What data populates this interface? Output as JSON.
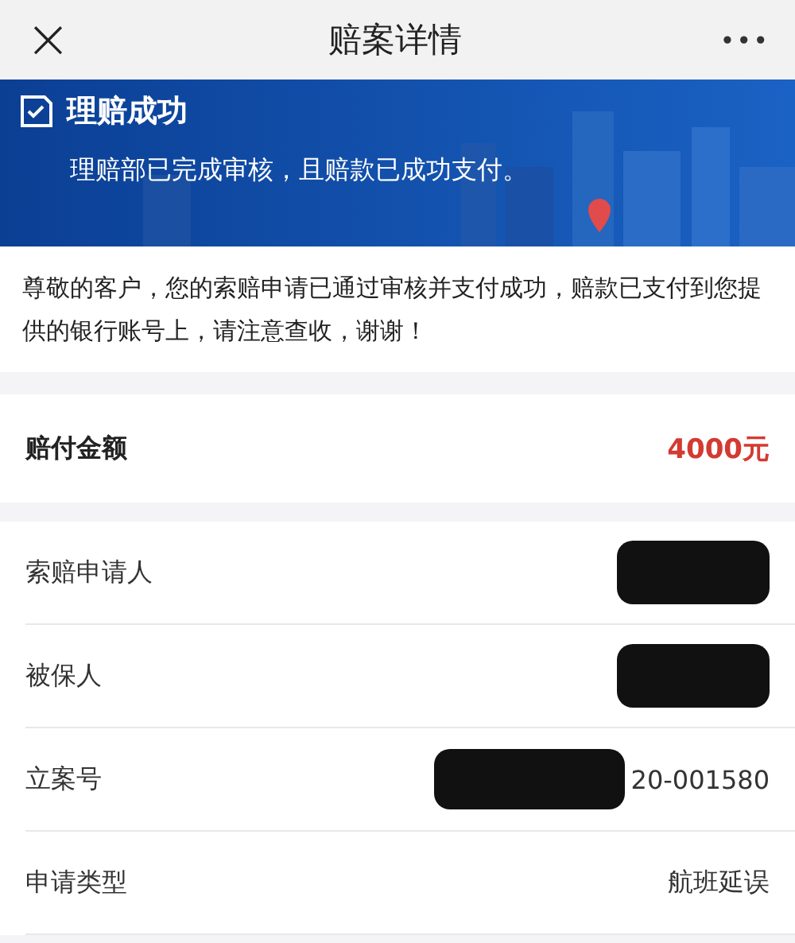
{
  "nav": {
    "close": "×",
    "title": "赔案详情",
    "more": "•••"
  },
  "banner": {
    "title": "理赔成功",
    "subtitle": "理赔部已完成审核，且赔款已成功支付。",
    "kind": "picture"
  },
  "message": "尊敬的客户，您的索赔申请已通过审核并支付成功，赔款已支付到您提供的银行账号上，请注意查收，谢谢！",
  "amount": {
    "label": "赔付金额",
    "value": "4000元"
  },
  "details": [
    {
      "label": "索赔申请人",
      "redacted": true
    },
    {
      "label": "被保人",
      "redacted": true
    },
    {
      "label": "立案号",
      "value": "20-001580",
      "redacted": true
    },
    {
      "label": "申请类型",
      "value": "航班延误"
    }
  ]
}
